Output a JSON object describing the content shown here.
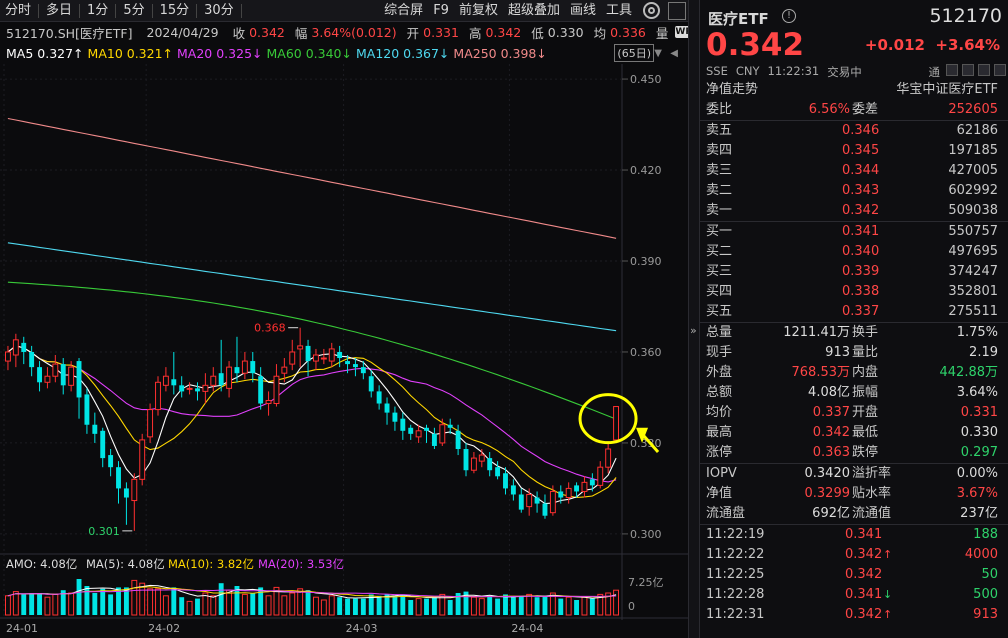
{
  "toolbar": {
    "left": [
      "分时",
      "多日",
      "1分",
      "5分",
      "15分",
      "30分"
    ],
    "right": [
      "综合屏",
      "F9",
      "前复权",
      "超级叠加",
      "画线",
      "工具"
    ]
  },
  "info": {
    "code": "512170.SH[医疗ETF]",
    "date": "2024/04/29",
    "close_l": "收",
    "close_v": "0.342",
    "amp_l": "幅",
    "amp_v": "3.64%(0.012)",
    "open_l": "开",
    "open_v": "0.331",
    "high_l": "高",
    "high_v": "0.342",
    "low_l": "低",
    "low_v": "0.330",
    "avg_l": "均",
    "avg_v": "0.336",
    "vol_l": "量",
    "badge": "WP"
  },
  "ma": {
    "ma5": "MA5 0.327↑",
    "ma10": "MA10 0.321↑",
    "ma20": "MA20 0.325↓",
    "ma60": "MA60 0.340↓",
    "ma120": "MA120 0.367↓",
    "ma250": "MA250 0.398↓",
    "days": "(65日)"
  },
  "colors": {
    "ma5": "#ffffff",
    "ma10": "#ffd700",
    "ma20": "#e040fb",
    "ma60": "#38c938",
    "ma120": "#4fd9f0",
    "ma250": "#f08a8a",
    "up": "#ff3030",
    "down": "#00e5e5",
    "highlight": "#ffff00"
  },
  "annotations": {
    "max": "0.368",
    "min": "0.301"
  },
  "amo": {
    "label": "AMO: 4.08亿",
    "ma5": "MA(5): 4.08亿",
    "ma10": "MA(10): 3.82亿",
    "ma20": "MA(20): 3.53亿",
    "scale_top": "7.25亿",
    "scale_zero": "0"
  },
  "xaxis": [
    "24-01",
    "24-02",
    "24-03",
    "24-04"
  ],
  "chart_data": {
    "type": "candlestick",
    "ylim": [
      0.297,
      0.452
    ],
    "yticks": [
      "0.450",
      "0.420",
      "0.390",
      "0.360",
      "0.330",
      "0.300"
    ],
    "candles": [
      [
        0.357,
        0.36,
        0.362,
        0.354
      ],
      [
        0.359,
        0.364,
        0.366,
        0.355
      ],
      [
        0.363,
        0.36,
        0.365,
        0.356
      ],
      [
        0.36,
        0.355,
        0.362,
        0.352
      ],
      [
        0.355,
        0.35,
        0.357,
        0.347
      ],
      [
        0.35,
        0.352,
        0.355,
        0.348
      ],
      [
        0.352,
        0.356,
        0.359,
        0.35
      ],
      [
        0.356,
        0.349,
        0.358,
        0.346
      ],
      [
        0.349,
        0.355,
        0.357,
        0.347
      ],
      [
        0.357,
        0.345,
        0.358,
        0.338
      ],
      [
        0.346,
        0.336,
        0.348,
        0.333
      ],
      [
        0.336,
        0.333,
        0.34,
        0.33
      ],
      [
        0.334,
        0.325,
        0.335,
        0.322
      ],
      [
        0.326,
        0.322,
        0.328,
        0.319
      ],
      [
        0.322,
        0.315,
        0.324,
        0.31
      ],
      [
        0.315,
        0.312,
        0.317,
        0.303
      ],
      [
        0.311,
        0.318,
        0.32,
        0.301
      ],
      [
        0.318,
        0.331,
        0.333,
        0.316
      ],
      [
        0.332,
        0.341,
        0.343,
        0.33
      ],
      [
        0.341,
        0.35,
        0.352,
        0.339
      ],
      [
        0.349,
        0.352,
        0.355,
        0.347
      ],
      [
        0.351,
        0.349,
        0.36,
        0.346
      ],
      [
        0.349,
        0.347,
        0.352,
        0.345
      ],
      [
        0.348,
        0.348,
        0.35,
        0.346
      ],
      [
        0.348,
        0.347,
        0.35,
        0.344
      ],
      [
        0.347,
        0.349,
        0.353,
        0.343
      ],
      [
        0.349,
        0.352,
        0.355,
        0.347
      ],
      [
        0.353,
        0.349,
        0.364,
        0.347
      ],
      [
        0.348,
        0.355,
        0.357,
        0.345
      ],
      [
        0.355,
        0.353,
        0.365,
        0.35
      ],
      [
        0.353,
        0.357,
        0.36,
        0.351
      ],
      [
        0.357,
        0.353,
        0.36,
        0.35
      ],
      [
        0.352,
        0.343,
        0.355,
        0.341
      ],
      [
        0.343,
        0.344,
        0.347,
        0.339
      ],
      [
        0.343,
        0.352,
        0.356,
        0.342
      ],
      [
        0.353,
        0.355,
        0.358,
        0.35
      ],
      [
        0.356,
        0.36,
        0.364,
        0.354
      ],
      [
        0.361,
        0.362,
        0.368,
        0.355
      ],
      [
        0.362,
        0.357,
        0.364,
        0.352
      ],
      [
        0.357,
        0.359,
        0.361,
        0.354
      ],
      [
        0.358,
        0.358,
        0.361,
        0.356
      ],
      [
        0.357,
        0.361,
        0.363,
        0.355
      ],
      [
        0.36,
        0.358,
        0.362,
        0.355
      ],
      [
        0.357,
        0.356,
        0.359,
        0.353
      ],
      [
        0.356,
        0.355,
        0.358,
        0.352
      ],
      [
        0.355,
        0.353,
        0.357,
        0.351
      ],
      [
        0.352,
        0.347,
        0.354,
        0.345
      ],
      [
        0.347,
        0.343,
        0.349,
        0.341
      ],
      [
        0.343,
        0.34,
        0.345,
        0.336
      ],
      [
        0.34,
        0.337,
        0.342,
        0.334
      ],
      [
        0.338,
        0.334,
        0.34,
        0.331
      ],
      [
        0.335,
        0.333,
        0.336,
        0.331
      ],
      [
        0.332,
        0.334,
        0.336,
        0.33
      ],
      [
        0.335,
        0.334,
        0.336,
        0.33
      ],
      [
        0.333,
        0.329,
        0.335,
        0.328
      ],
      [
        0.33,
        0.336,
        0.338,
        0.329
      ],
      [
        0.336,
        0.335,
        0.338,
        0.333
      ],
      [
        0.334,
        0.328,
        0.336,
        0.326
      ],
      [
        0.328,
        0.321,
        0.33,
        0.319
      ],
      [
        0.321,
        0.325,
        0.327,
        0.32
      ],
      [
        0.324,
        0.326,
        0.328,
        0.322
      ],
      [
        0.325,
        0.321,
        0.327,
        0.319
      ],
      [
        0.322,
        0.319,
        0.324,
        0.318
      ],
      [
        0.32,
        0.315,
        0.322,
        0.313
      ],
      [
        0.316,
        0.313,
        0.318,
        0.311
      ],
      [
        0.313,
        0.308,
        0.315,
        0.307
      ],
      [
        0.309,
        0.313,
        0.315,
        0.306
      ],
      [
        0.312,
        0.31,
        0.314,
        0.307
      ],
      [
        0.31,
        0.306,
        0.313,
        0.305
      ],
      [
        0.307,
        0.314,
        0.316,
        0.306
      ],
      [
        0.314,
        0.312,
        0.316,
        0.31
      ],
      [
        0.312,
        0.315,
        0.317,
        0.31
      ],
      [
        0.316,
        0.314,
        0.317,
        0.312
      ],
      [
        0.314,
        0.317,
        0.319,
        0.312
      ],
      [
        0.318,
        0.316,
        0.32,
        0.314
      ],
      [
        0.316,
        0.322,
        0.324,
        0.315
      ],
      [
        0.322,
        0.328,
        0.33,
        0.32
      ],
      [
        0.331,
        0.342,
        0.342,
        0.33
      ]
    ]
  },
  "quote": {
    "name": "医疗ETF",
    "info": "!",
    "code": "512170",
    "price": "0.342",
    "change": "+0.012",
    "pct": "+3.64%",
    "mkt": [
      "SSE",
      "CNY",
      "11:22:31",
      "交易中"
    ],
    "tong": "通",
    "jing": "净值走势",
    "fund": "华宝中证医疗ETF",
    "webi_l": "委比",
    "webi_v": "6.56%",
    "wecha_l": "委差",
    "wecha_v": "252605",
    "sells": [
      [
        "卖五",
        "0.346",
        "62186"
      ],
      [
        "卖四",
        "0.345",
        "197185"
      ],
      [
        "卖三",
        "0.344",
        "427005"
      ],
      [
        "卖二",
        "0.343",
        "602992"
      ],
      [
        "卖一",
        "0.342",
        "509038"
      ]
    ],
    "buys": [
      [
        "买一",
        "0.341",
        "550757"
      ],
      [
        "买二",
        "0.340",
        "497695"
      ],
      [
        "买三",
        "0.339",
        "374247"
      ],
      [
        "买四",
        "0.338",
        "352801"
      ],
      [
        "买五",
        "0.337",
        "275511"
      ]
    ],
    "stats": [
      [
        "总量",
        "1211.41万",
        "换手",
        "1.75%"
      ],
      [
        "现手",
        "913",
        "量比",
        "2.19"
      ],
      [
        "外盘",
        "768.53万",
        "内盘",
        "442.88万"
      ],
      [
        "总额",
        "4.08亿",
        "振幅",
        "3.64%"
      ],
      [
        "均价",
        "0.337",
        "开盘",
        "0.331"
      ],
      [
        "最高",
        "0.342",
        "最低",
        "0.330"
      ],
      [
        "涨停",
        "0.363",
        "跌停",
        "0.297"
      ]
    ],
    "stats2": [
      [
        "IOPV",
        "0.3420",
        "溢折率",
        "0.00%"
      ],
      [
        "净值",
        "0.3299",
        "贴水率",
        "3.67%"
      ],
      [
        "流通盘",
        "692亿",
        "流通值",
        "237亿"
      ]
    ],
    "ticks": [
      [
        "11:22:19",
        "0.341",
        "",
        "188"
      ],
      [
        "11:22:22",
        "0.342",
        "↑",
        "4000"
      ],
      [
        "11:22:25",
        "0.342",
        "",
        "50"
      ],
      [
        "11:22:28",
        "0.341",
        "↓",
        "500"
      ],
      [
        "11:22:31",
        "0.342",
        "↑",
        "913"
      ]
    ]
  }
}
